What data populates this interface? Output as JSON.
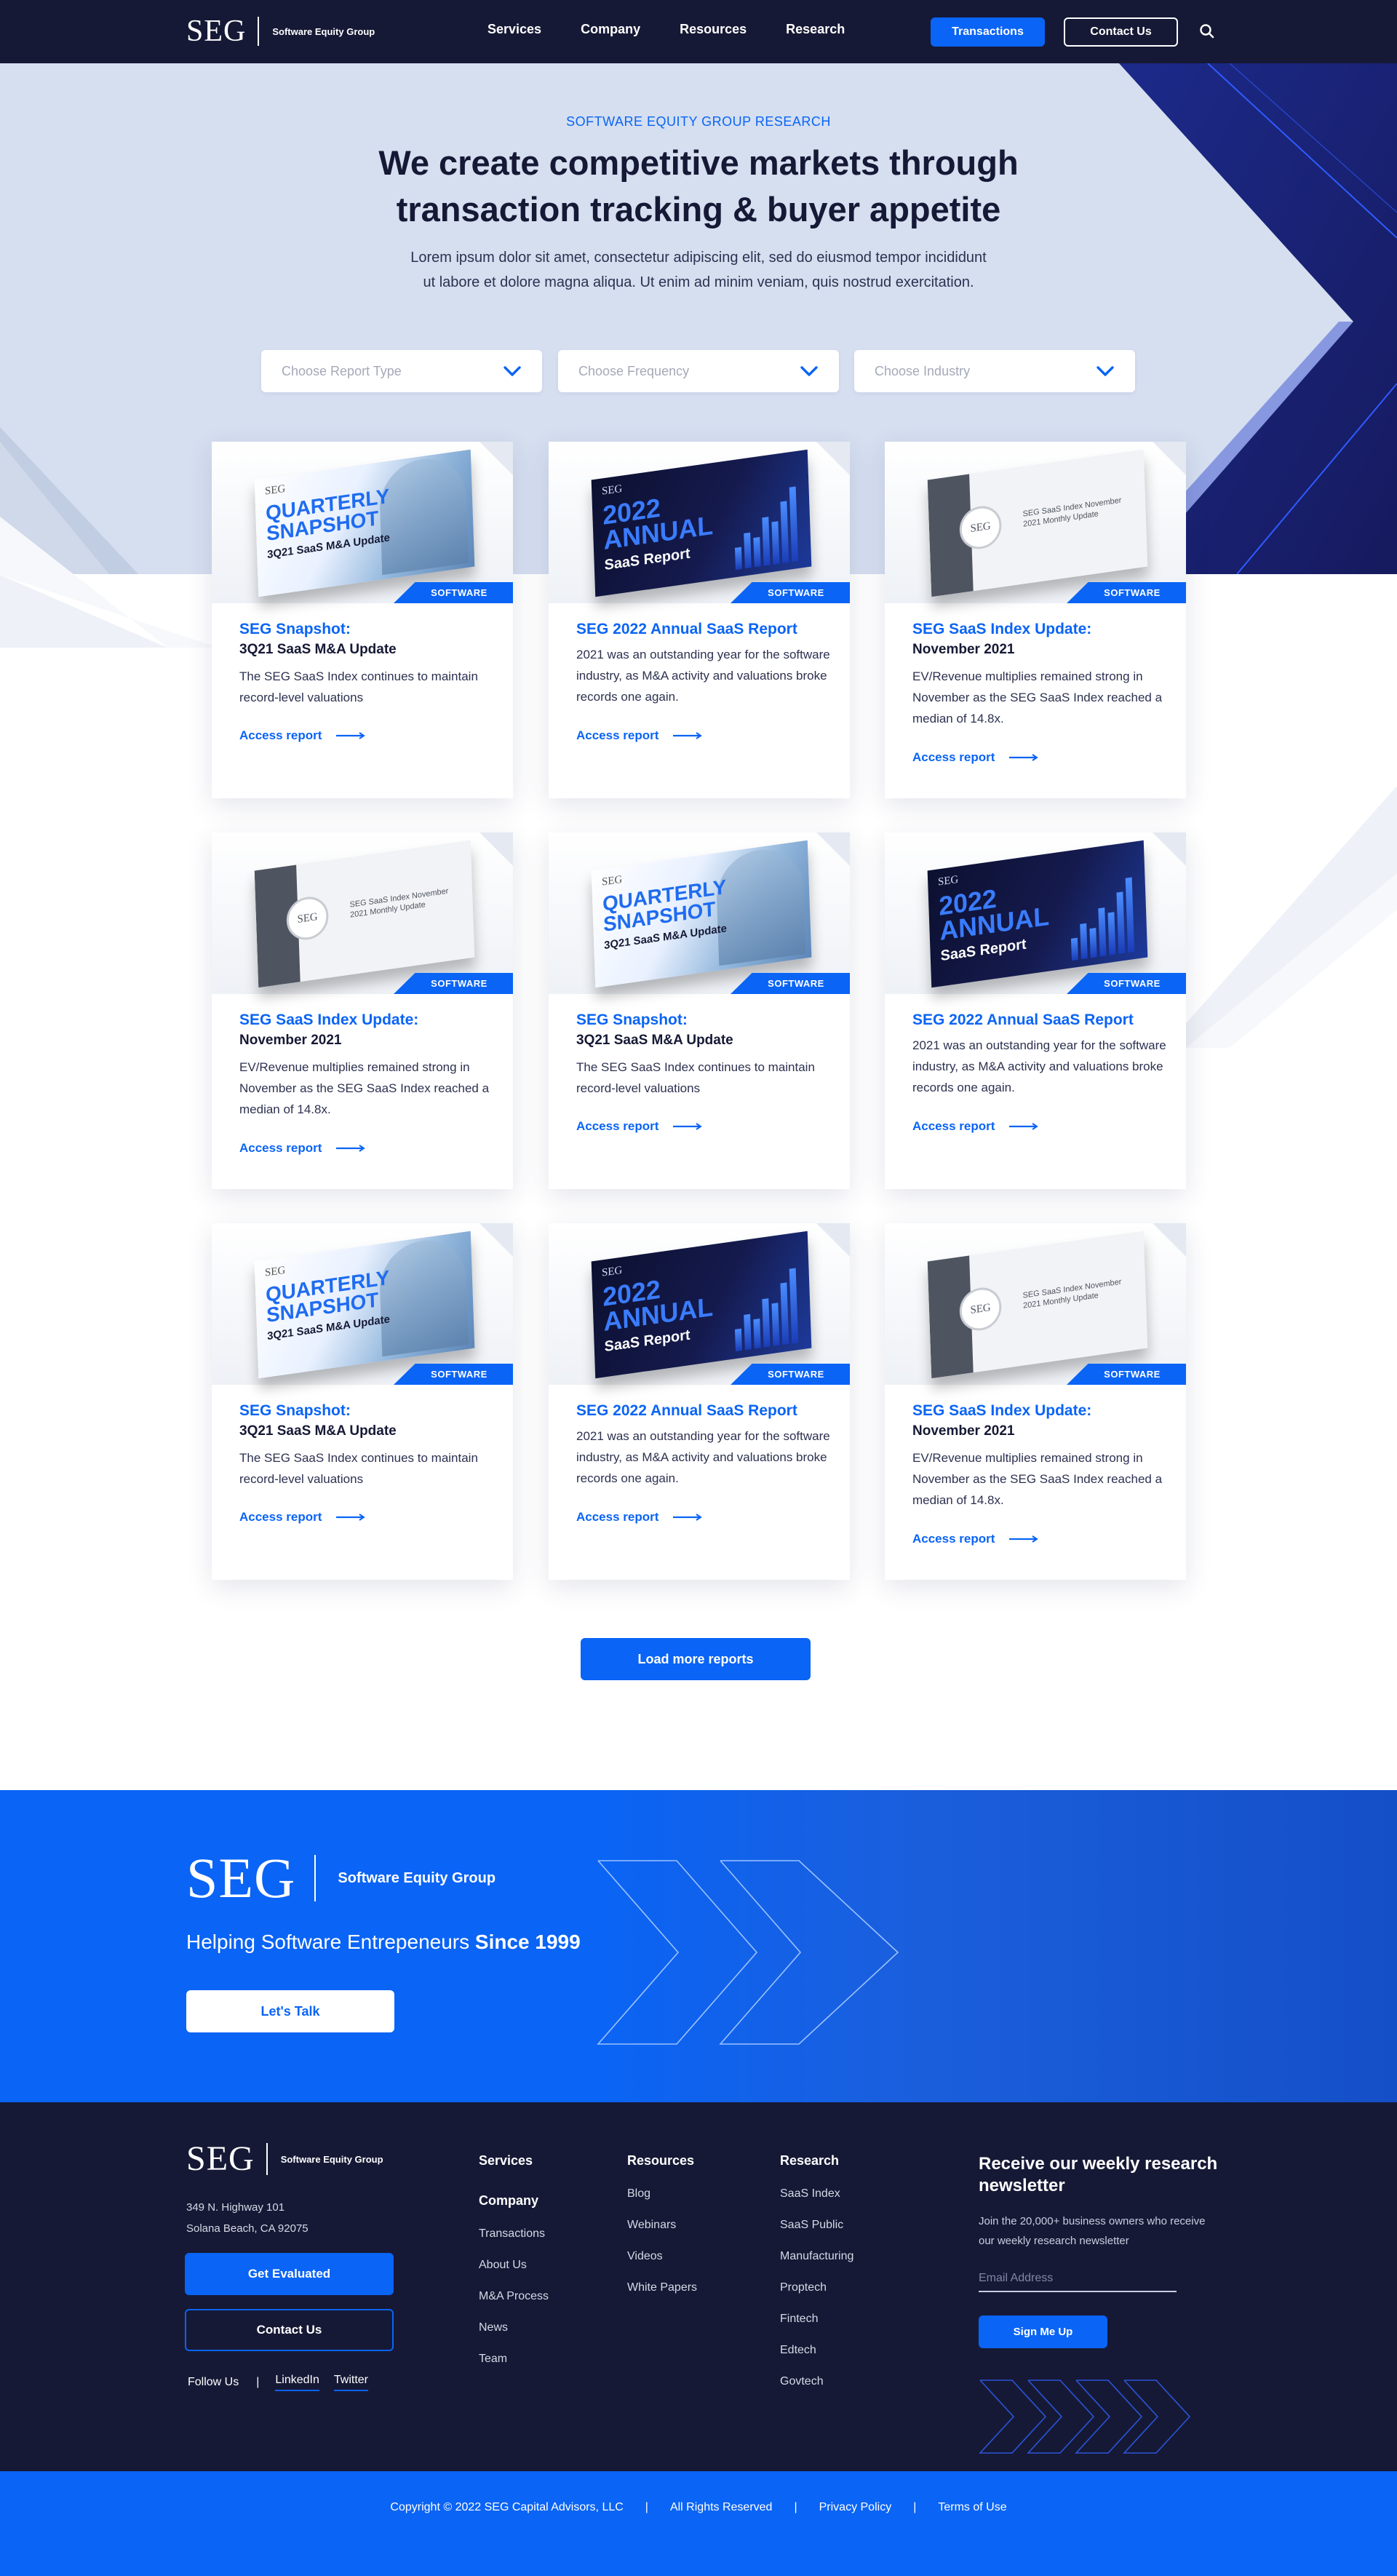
{
  "header": {
    "logo_mark": "SEG",
    "logo_text": "Software Equity Group",
    "nav": [
      "Services",
      "Company",
      "Resources",
      "Research"
    ],
    "transactions_label": "Transactions",
    "contact_label": "Contact Us",
    "search_icon": "search-icon"
  },
  "hero": {
    "eyebrow": "SOFTWARE EQUITY GROUP RESEARCH",
    "title": "We create competitive markets through transaction tracking & buyer appetite",
    "body": "Lorem ipsum dolor sit amet, consectetur adipiscing elit, sed do eiusmod tempor incididunt ut labore et dolore magna aliqua. Ut enim ad minim veniam, quis nostrud exercitation.",
    "filters": [
      {
        "placeholder": "Choose Report Type"
      },
      {
        "placeholder": "Choose Frequency"
      },
      {
        "placeholder": "Choose Industry"
      }
    ]
  },
  "cards": [
    {
      "cover": "quarterly",
      "tag": "SOFTWARE",
      "title": "SEG Snapshot:",
      "subtitle": "3Q21 SaaS M&A Update",
      "body": "The SEG SaaS Index continues to maintain record-level valuations",
      "link": "Access report"
    },
    {
      "cover": "annual",
      "tag": "SOFTWARE",
      "title": "SEG 2022 Annual SaaS Report",
      "subtitle": "",
      "body": "2021 was an outstanding year for the software industry, as M&A activity and valuations broke records one again.",
      "link": "Access report"
    },
    {
      "cover": "index",
      "tag": "SOFTWARE",
      "title": "SEG SaaS Index Update:",
      "subtitle": "November 2021",
      "body": "EV/Revenue multiplies remained strong in November as the SEG SaaS Index reached a median of 14.8x.",
      "link": "Access report"
    },
    {
      "cover": "index",
      "tag": "SOFTWARE",
      "title": "SEG SaaS Index Update:",
      "subtitle": "November 2021",
      "body": "EV/Revenue multiplies remained strong in November as the SEG SaaS Index reached a median of 14.8x.",
      "link": "Access report"
    },
    {
      "cover": "quarterly",
      "tag": "SOFTWARE",
      "title": "SEG Snapshot:",
      "subtitle": "3Q21 SaaS M&A Update",
      "body": "The SEG SaaS Index continues to maintain record-level valuations",
      "link": "Access report"
    },
    {
      "cover": "annual",
      "tag": "SOFTWARE",
      "title": "SEG 2022 Annual SaaS Report",
      "subtitle": "",
      "body": "2021 was an outstanding year for the software industry, as M&A activity and valuations broke records one again.",
      "link": "Access report"
    },
    {
      "cover": "quarterly",
      "tag": "SOFTWARE",
      "title": "SEG Snapshot:",
      "subtitle": "3Q21 SaaS M&A Update",
      "body": "The SEG SaaS Index continues to maintain record-level valuations",
      "link": "Access report"
    },
    {
      "cover": "annual",
      "tag": "SOFTWARE",
      "title": "SEG 2022 Annual SaaS Report",
      "subtitle": "",
      "body": "2021 was an outstanding year for the software industry, as M&A activity and valuations broke records one again.",
      "link": "Access report"
    },
    {
      "cover": "index",
      "tag": "SOFTWARE",
      "title": "SEG SaaS Index Update:",
      "subtitle": "November 2021",
      "body": "EV/Revenue multiplies remained strong in November as the SEG SaaS Index reached a median of 14.8x.",
      "link": "Access report"
    }
  ],
  "covers": {
    "quarterly": {
      "logo": "SEG",
      "big": "QUARTERLY SNAPSHOT",
      "small": "3Q21 SaaS M&A Update"
    },
    "annual": {
      "logo": "SEG",
      "big": "2022 ANNUAL",
      "small": "SaaS Report"
    },
    "index": {
      "seal": "SEG",
      "text": "SEG SaaS Index November 2021 Monthly Update"
    }
  },
  "load_more_label": "Load more reports",
  "cta": {
    "logo_mark": "SEG",
    "logo_text": "Software Equity Group",
    "tagline_plain": "Helping Software Entrepeneurs ",
    "tagline_bold": "Since 1999",
    "button_label": "Let's Talk"
  },
  "footer": {
    "logo_mark": "SEG",
    "logo_text": "Software Equity Group",
    "address_line1": "349 N. Highway 101",
    "address_line2": "Solana Beach, CA 92075",
    "evaluate_label": "Get Evaluated",
    "contact_label": "Contact Us",
    "follow_label": "Follow Us",
    "follow_sep": "|",
    "linkedin": "LinkedIn",
    "twitter": "Twitter",
    "services_head": "Services",
    "company_head": "Company",
    "company_links": [
      "Transactions",
      "About Us",
      "M&A Process",
      "News",
      "Team"
    ],
    "resources_head": "Resources",
    "resources_links": [
      "Blog",
      "Webinars",
      "Videos",
      "White Papers"
    ],
    "research_head": "Research",
    "research_links": [
      "SaaS Index",
      "SaaS Public",
      "Manufacturing",
      "Proptech",
      "Fintech",
      "Edtech",
      "Govtech"
    ],
    "newsletter_title": "Receive our weekly research newsletter",
    "newsletter_body": "Join the 20,000+ business owners who receive our weekly research newsletter",
    "email_placeholder": "Email Address",
    "signup_label": "Sign Me Up"
  },
  "bottom_bar": {
    "copyright": "Copyright © 2022 SEG Capital Advisors, LLC",
    "rights": "All Rights Reserved",
    "privacy": "Privacy Policy",
    "terms": "Terms of Use",
    "sep": "|"
  },
  "colors": {
    "navy": "#161935",
    "blue": "#0a64f5",
    "hero_bg": "#d5dff0"
  }
}
